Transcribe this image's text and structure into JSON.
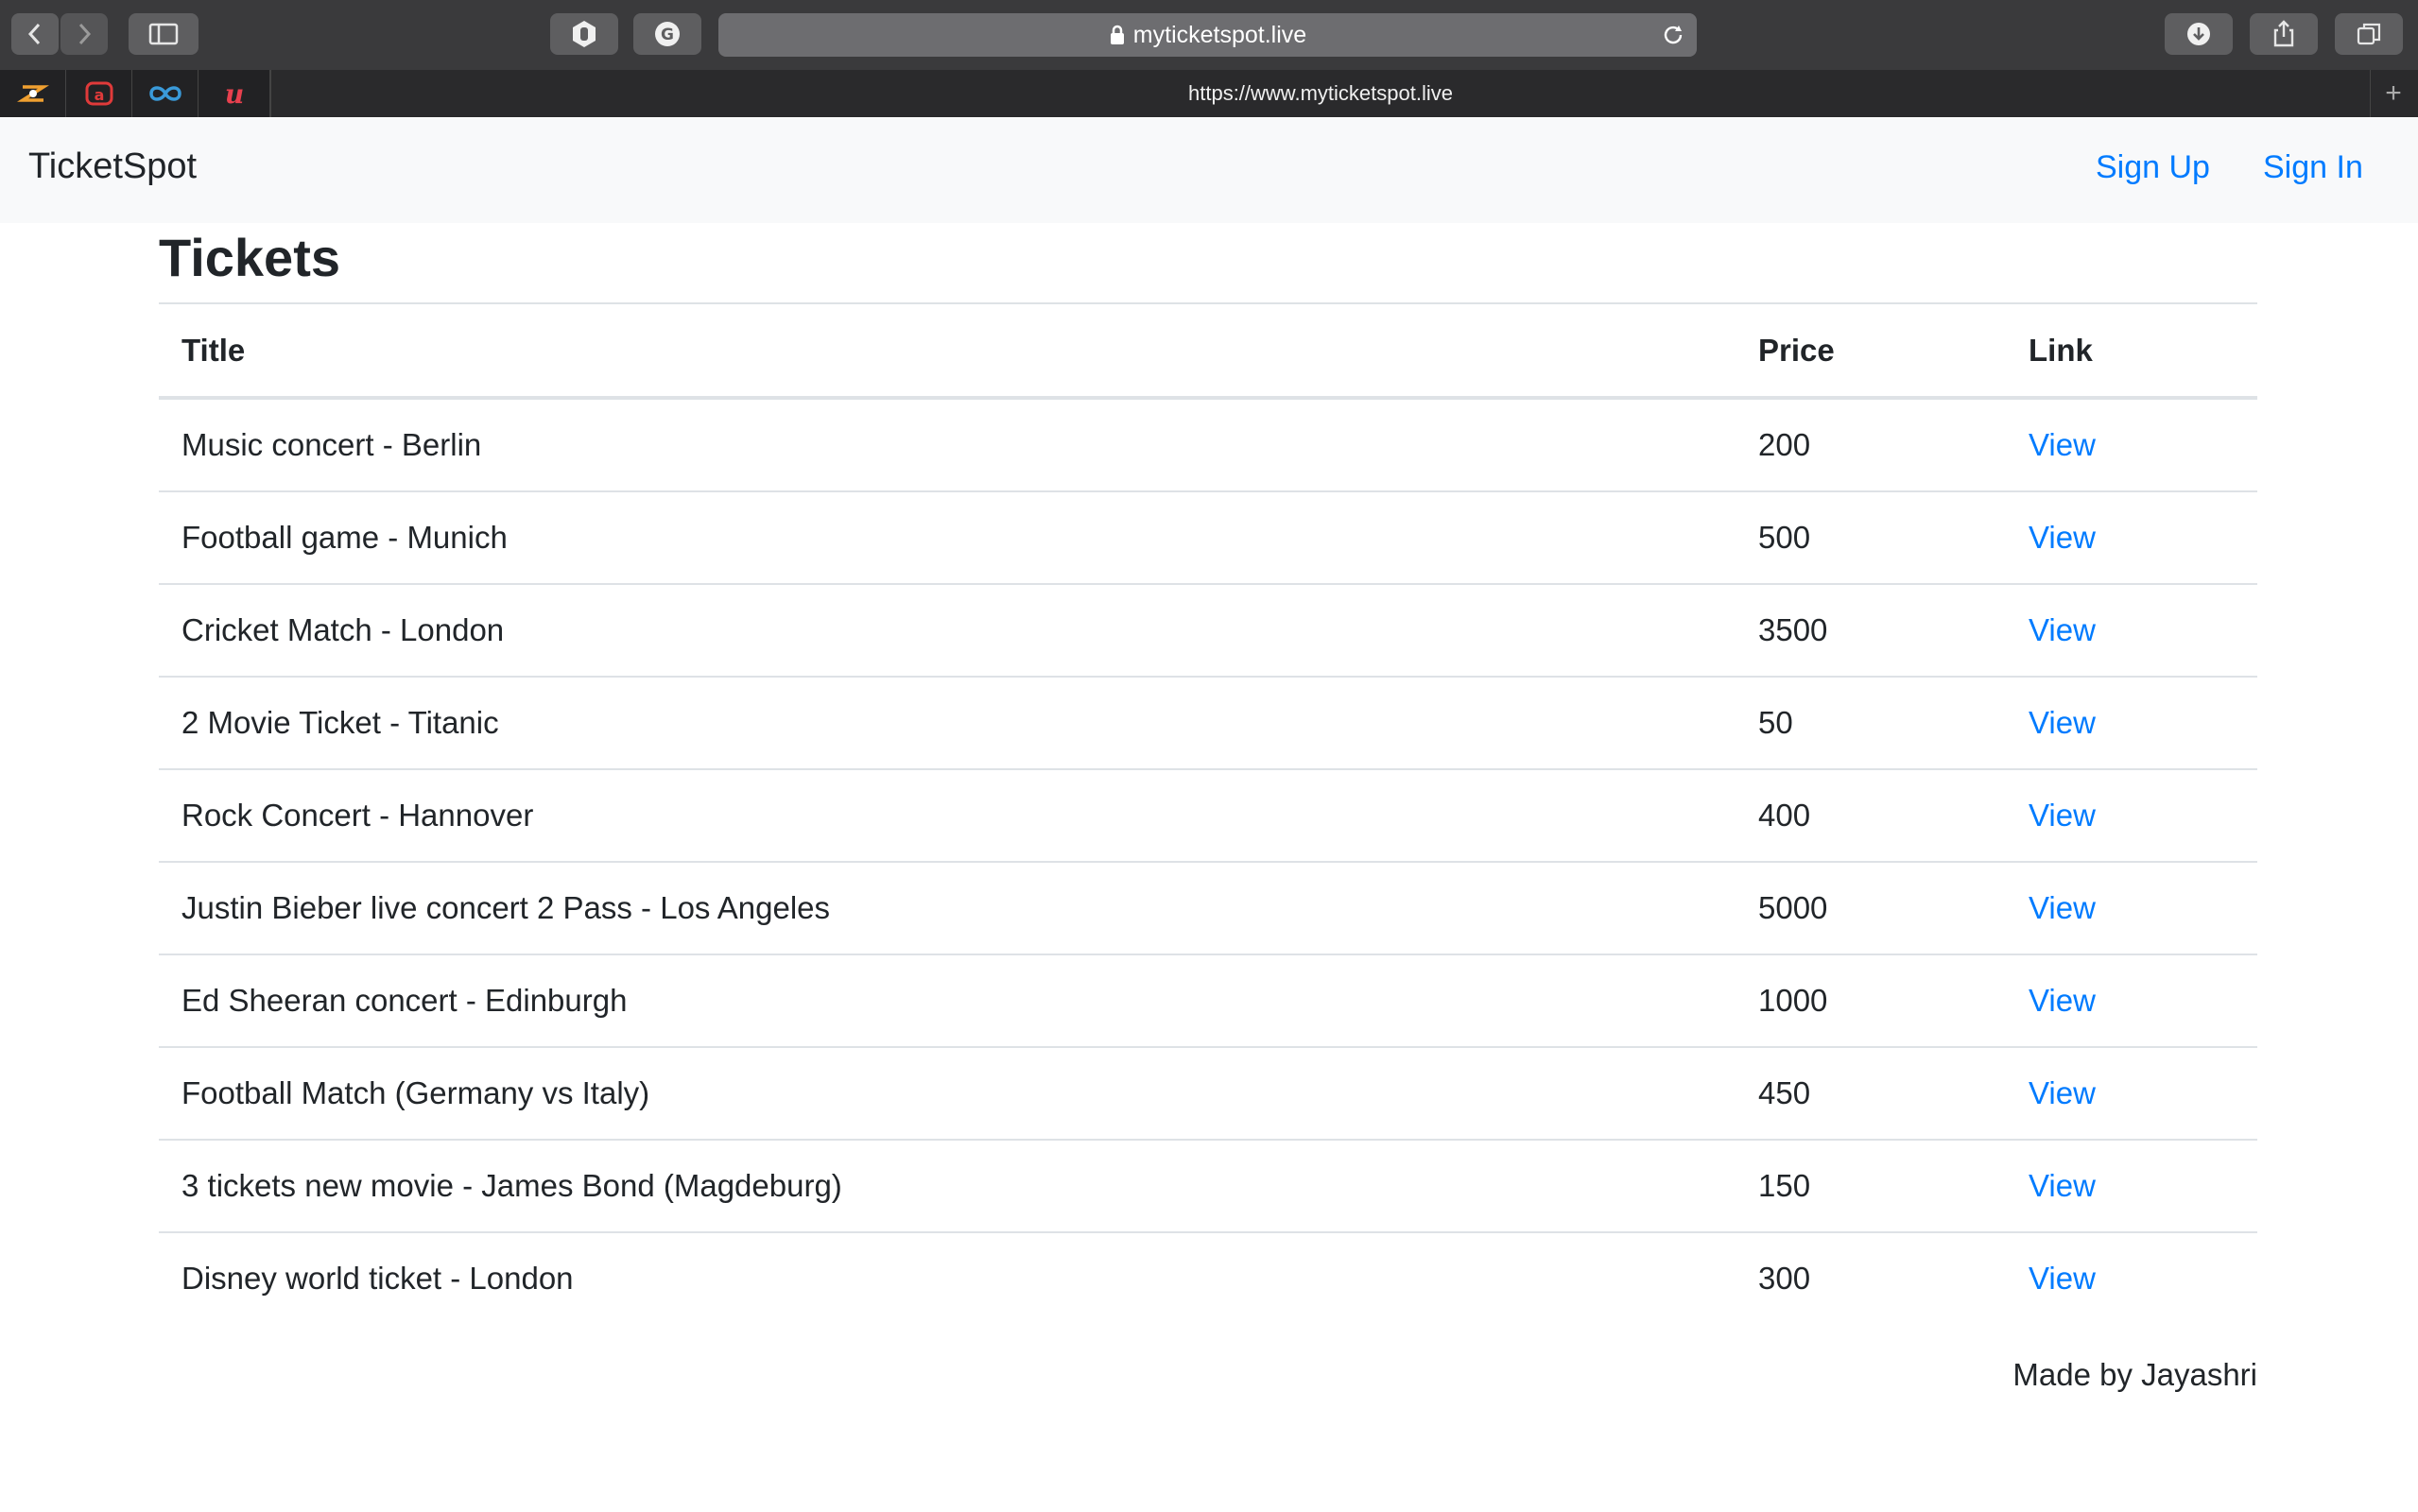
{
  "browser": {
    "url_display": "myticketspot.live",
    "tab_title": "https://www.myticketspot.live"
  },
  "navbar": {
    "brand": "TicketSpot",
    "links": [
      "Sign Up",
      "Sign In"
    ]
  },
  "page": {
    "heading": "Tickets"
  },
  "table": {
    "headers": [
      "Title",
      "Price",
      "Link"
    ],
    "rows": [
      {
        "title": "Music concert - Berlin",
        "price": "200",
        "link": "View"
      },
      {
        "title": "Football game - Munich",
        "price": "500",
        "link": "View"
      },
      {
        "title": "Cricket Match - London",
        "price": "3500",
        "link": "View"
      },
      {
        "title": "2 Movie Ticket - Titanic",
        "price": "50",
        "link": "View"
      },
      {
        "title": "Rock Concert - Hannover",
        "price": "400",
        "link": "View"
      },
      {
        "title": "Justin Bieber live concert 2 Pass - Los Angeles",
        "price": "5000",
        "link": "View"
      },
      {
        "title": "Ed Sheeran concert - Edinburgh",
        "price": "1000",
        "link": "View"
      },
      {
        "title": "Football Match (Germany vs Italy)",
        "price": "450",
        "link": "View"
      },
      {
        "title": "3 tickets new movie - James Bond (Magdeburg)",
        "price": "150",
        "link": "View"
      },
      {
        "title": "Disney world ticket - London",
        "price": "300",
        "link": "View"
      }
    ]
  },
  "footer": {
    "text": "Made by Jayashri"
  },
  "colors": {
    "link": "#007bff",
    "navbar_bg": "#f8f9fa",
    "browser_chrome": "#3a3a3c"
  }
}
